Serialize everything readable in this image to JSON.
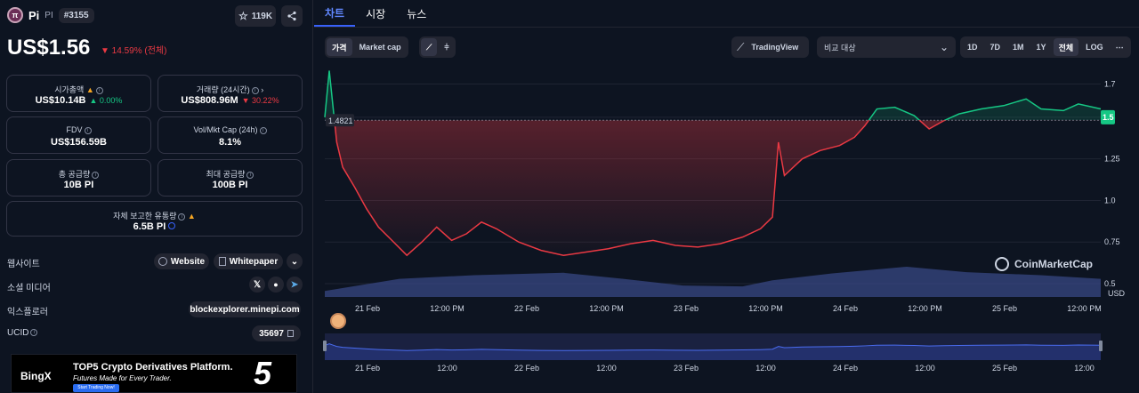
{
  "coin": {
    "logo_text": "π",
    "name": "Pi",
    "symbol": "PI",
    "rank": "#3155",
    "watchlist_count": "119K",
    "price": "US$1.56",
    "change": "▼ 14.59% (전체)"
  },
  "stats": {
    "market_cap": {
      "label": "시가총액",
      "value": "US$10.14B",
      "change": "▲ 0.00%"
    },
    "volume": {
      "label": "거래량 (24시간)",
      "value": "US$808.96M",
      "change": "▼ 30.22%"
    },
    "fdv": {
      "label": "FDV",
      "value": "US$156.59B"
    },
    "vol_mkt_cap": {
      "label": "Vol/Mkt Cap (24h)",
      "value": "8.1%"
    },
    "total_supply": {
      "label": "총 공급량",
      "value": "10B PI"
    },
    "max_supply": {
      "label": "최대 공급량",
      "value": "100B PI"
    },
    "self_reported": {
      "label": "자체 보고한 유통량",
      "value": "6.5B PI"
    }
  },
  "links": {
    "website_label": "웹사이트",
    "website_btn": "Website",
    "whitepaper_btn": "Whitepaper",
    "social_label": "소셜 미디어",
    "explorer_label": "익스플로러",
    "explorer_value": "blockexplorer.minepi.com",
    "ucid_label": "UCID",
    "ucid_value": "35697"
  },
  "ad": {
    "logo": "BingX",
    "title": "TOP5 Crypto Derivatives Platform.",
    "subtitle": "Futures Made for Every Trader.",
    "button": "Start Trading Now!",
    "badge": "5"
  },
  "tabs": [
    "차트",
    "시장",
    "뉴스"
  ],
  "controls": {
    "price_tab": "가격",
    "marketcap_tab": "Market cap",
    "tradingview": "TradingView",
    "compare_placeholder": "비교 대상",
    "ranges": [
      "1D",
      "7D",
      "1M",
      "1Y",
      "전체"
    ],
    "log": "LOG"
  },
  "watermark": "CoinMarketCap",
  "colors": {
    "up": "#16c784",
    "down": "#ea3943",
    "accent": "#3861fb",
    "volume": "#3a4a8a"
  },
  "chart_data": {
    "type": "line",
    "currency_label": "USD",
    "reference_price": 1.4821,
    "last_price": 1.5,
    "y_ticks": [
      0.5,
      0.75,
      1.0,
      1.25,
      1.5,
      1.7
    ],
    "x_ticks": [
      "21 Feb",
      "12:00 PM",
      "22 Feb",
      "12:00 PM",
      "23 Feb",
      "12:00 PM",
      "24 Feb",
      "12:00 PM",
      "25 Feb",
      "12:00 PM"
    ],
    "nav_x_ticks": [
      "21 Feb",
      "12:00",
      "22 Feb",
      "12:00",
      "23 Feb",
      "12:00",
      "24 Feb",
      "12:00",
      "25 Feb",
      "12:00"
    ],
    "ylim": [
      0.42,
      1.82
    ],
    "x_range": [
      0,
      5.2
    ],
    "price": [
      [
        0.0,
        1.5
      ],
      [
        0.03,
        1.78
      ],
      [
        0.06,
        1.52
      ],
      [
        0.08,
        1.35
      ],
      [
        0.12,
        1.2
      ],
      [
        0.2,
        1.08
      ],
      [
        0.28,
        0.95
      ],
      [
        0.36,
        0.84
      ],
      [
        0.45,
        0.76
      ],
      [
        0.55,
        0.67
      ],
      [
        0.65,
        0.75
      ],
      [
        0.75,
        0.84
      ],
      [
        0.85,
        0.76
      ],
      [
        0.95,
        0.8
      ],
      [
        1.05,
        0.87
      ],
      [
        1.15,
        0.83
      ],
      [
        1.3,
        0.75
      ],
      [
        1.45,
        0.7
      ],
      [
        1.6,
        0.67
      ],
      [
        1.75,
        0.69
      ],
      [
        1.9,
        0.71
      ],
      [
        2.05,
        0.74
      ],
      [
        2.2,
        0.76
      ],
      [
        2.35,
        0.73
      ],
      [
        2.5,
        0.72
      ],
      [
        2.65,
        0.74
      ],
      [
        2.8,
        0.78
      ],
      [
        2.92,
        0.83
      ],
      [
        3.0,
        0.9
      ],
      [
        3.04,
        1.35
      ],
      [
        3.08,
        1.15
      ],
      [
        3.2,
        1.25
      ],
      [
        3.32,
        1.3
      ],
      [
        3.45,
        1.33
      ],
      [
        3.55,
        1.38
      ],
      [
        3.62,
        1.45
      ],
      [
        3.7,
        1.55
      ],
      [
        3.82,
        1.56
      ],
      [
        3.95,
        1.51
      ],
      [
        4.05,
        1.43
      ],
      [
        4.15,
        1.48
      ],
      [
        4.25,
        1.52
      ],
      [
        4.4,
        1.55
      ],
      [
        4.55,
        1.57
      ],
      [
        4.7,
        1.61
      ],
      [
        4.8,
        1.55
      ],
      [
        4.95,
        1.54
      ],
      [
        5.05,
        1.58
      ],
      [
        5.2,
        1.55
      ]
    ],
    "volume": [
      [
        0.0,
        0.2
      ],
      [
        0.5,
        0.6
      ],
      [
        1.0,
        0.72
      ],
      [
        1.6,
        0.8
      ],
      [
        2.0,
        0.6
      ],
      [
        2.4,
        0.38
      ],
      [
        2.8,
        0.35
      ],
      [
        3.0,
        0.55
      ],
      [
        3.4,
        0.78
      ],
      [
        3.9,
        1.0
      ],
      [
        4.3,
        0.82
      ],
      [
        4.8,
        0.72
      ],
      [
        5.2,
        0.6
      ]
    ]
  }
}
